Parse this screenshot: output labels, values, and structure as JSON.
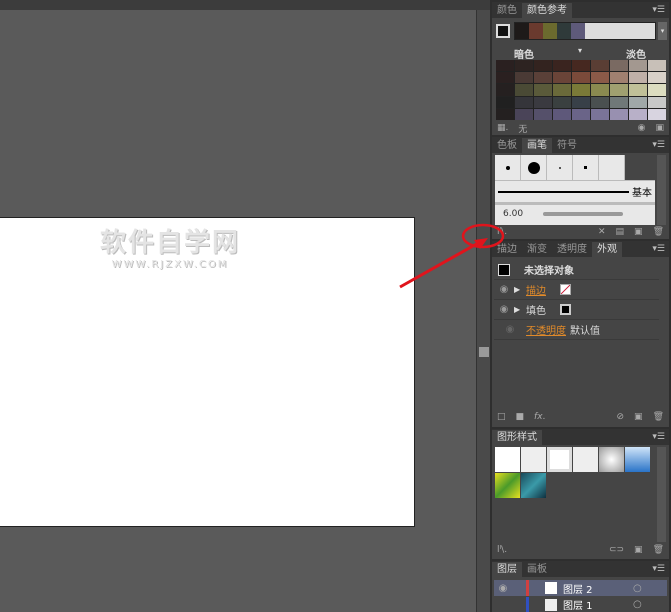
{
  "watermark": {
    "title": "软件自学网",
    "url": "WWW.RJZXW.COM"
  },
  "color_guide": {
    "tabs": [
      "颜色",
      "颜色参考"
    ],
    "dark_label": "暗色",
    "light_label": "淡色",
    "none_label": "无",
    "harmony_colors": [
      "#1e1a19",
      "#6a3a2e",
      "#6b6a2e",
      "#2f3a3a",
      "#5e5a7a"
    ],
    "grid_rows": [
      [
        "#2a2020",
        "#2d2321",
        "#33231f",
        "#3a241f",
        "#462820",
        "#5a3e34",
        "#7a6a62",
        "#a39890",
        "#c8c0b8"
      ],
      [
        "#2a2020",
        "#4a3a35",
        "#5a4038",
        "#6a4438",
        "#7a4a3a",
        "#8a5a48",
        "#a08070",
        "#c0b0a8",
        "#d8d0c8"
      ],
      [
        "#252020",
        "#4a4a35",
        "#5a5a3a",
        "#6a6a3a",
        "#7a7a38",
        "#8a8a50",
        "#a0a070",
        "#c0c098",
        "#dcdcc0"
      ],
      [
        "#202020",
        "#35353a",
        "#3a3a40",
        "#3a4040",
        "#384048",
        "#4a5050",
        "#707878",
        "#a0a8a8",
        "#c8c8c8"
      ],
      [
        "#242020",
        "#4a4458",
        "#55506a",
        "#5e587a",
        "#6a6488",
        "#7a7498",
        "#9890b0",
        "#b8b0c8",
        "#d8d4e0"
      ]
    ]
  },
  "brushes": {
    "tabs": [
      "色板",
      "画笔",
      "符号"
    ],
    "basic_label": "基本",
    "size_label": "6.00"
  },
  "appearance": {
    "tabs": [
      "描边",
      "渐变",
      "透明度",
      "外观"
    ],
    "no_selection": "未选择对象",
    "stroke_label": "描边",
    "fill_label": "填色",
    "opacity_label": "不透明度",
    "opacity_value": "默认值"
  },
  "graphic_styles": {
    "tabs": [
      "图形样式"
    ]
  },
  "layers": {
    "tabs": [
      "图层",
      "画板"
    ],
    "items": [
      {
        "name": "图层 2"
      },
      {
        "name": "图层 1"
      }
    ]
  },
  "annotation_color": "#e0141c"
}
